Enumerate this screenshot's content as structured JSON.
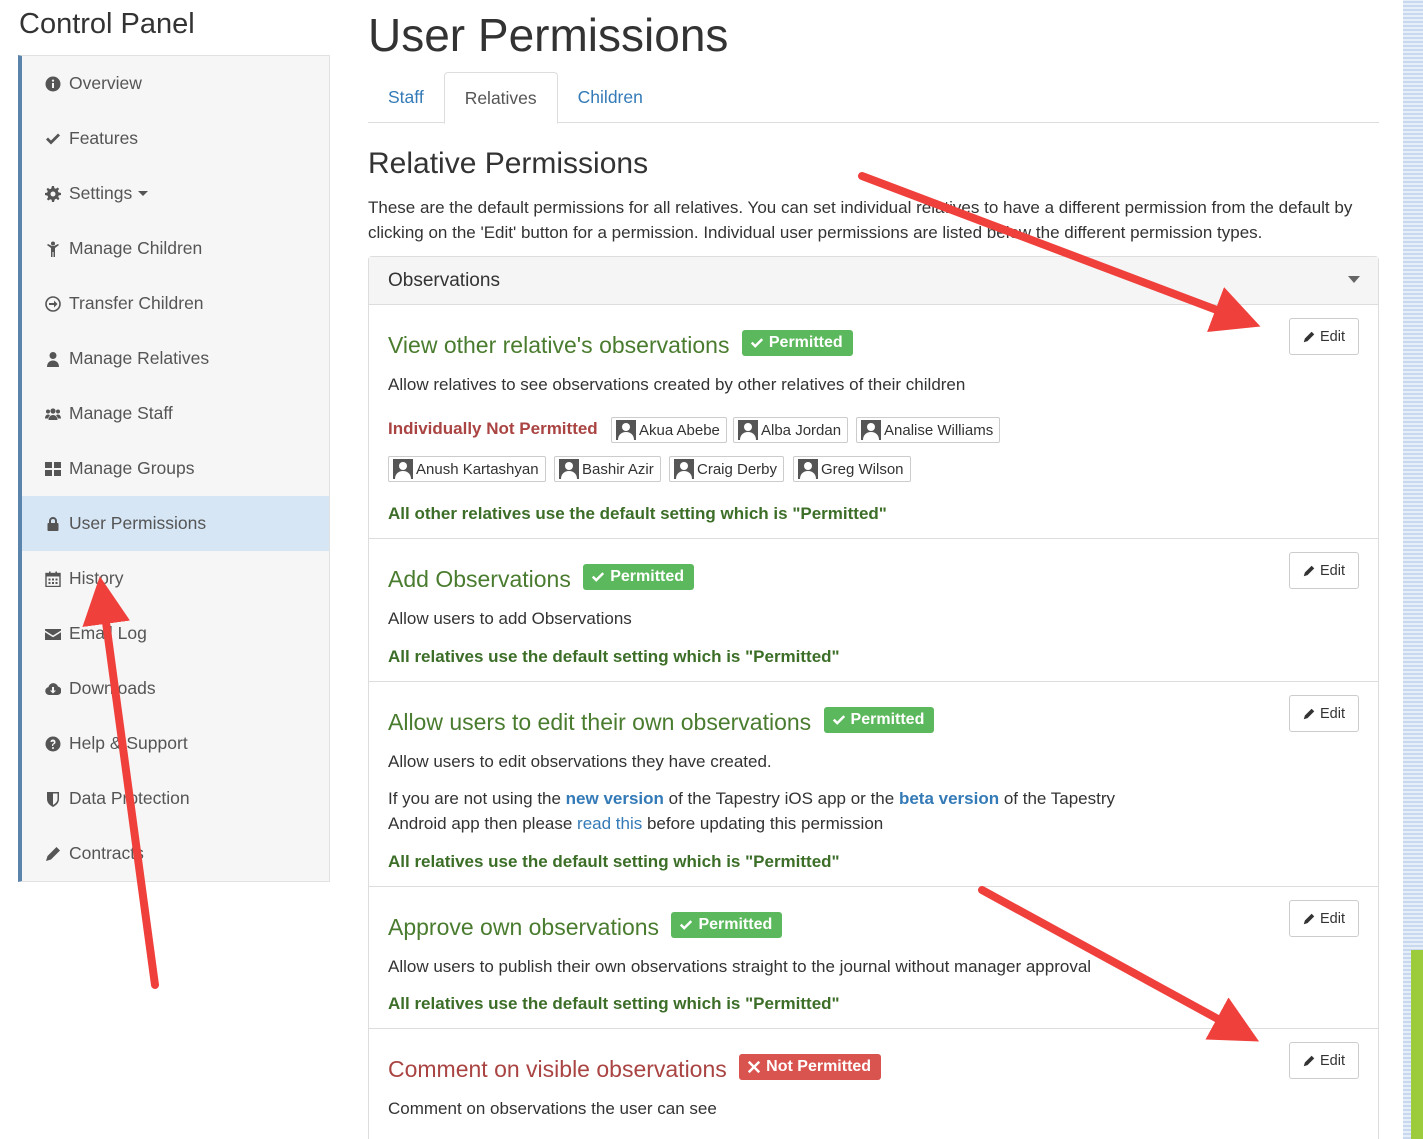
{
  "sidebar": {
    "title": "Control Panel",
    "items": [
      {
        "label": "Overview",
        "icon": "info-icon"
      },
      {
        "label": "Features",
        "icon": "check-icon"
      },
      {
        "label": "Settings",
        "icon": "gear-icon"
      },
      {
        "label": "Manage Children",
        "icon": "child-icon"
      },
      {
        "label": "Transfer Children",
        "icon": "transfer-icon"
      },
      {
        "label": "Manage Relatives",
        "icon": "user-icon"
      },
      {
        "label": "Manage Staff",
        "icon": "users-icon"
      },
      {
        "label": "Manage Groups",
        "icon": "groups-icon"
      },
      {
        "label": "User Permissions",
        "icon": "lock-icon",
        "active": true
      },
      {
        "label": "History",
        "icon": "calendar-icon"
      },
      {
        "label": "Email Log",
        "icon": "envelope-icon"
      },
      {
        "label": "Downloads",
        "icon": "cloud-download-icon"
      },
      {
        "label": "Help & Support",
        "icon": "question-icon"
      },
      {
        "label": "Data Protection",
        "icon": "shield-icon"
      },
      {
        "label": "Contracts",
        "icon": "pencil-icon"
      }
    ]
  },
  "main": {
    "title": "User Permissions",
    "tabs": [
      {
        "label": "Staff"
      },
      {
        "label": "Relatives",
        "active": true
      },
      {
        "label": "Children"
      }
    ],
    "section_title": "Relative Permissions",
    "section_desc": "These are the default permissions for all relatives. You can set individual relatives to have a different permission from the default by clicking on the 'Edit' button for a permission. Individual user permissions are listed below the different permission types.",
    "panel_heading": "Observations",
    "edit_label": "Edit",
    "permissions": [
      {
        "title": "View other relative's observations",
        "status": "Permitted",
        "desc": "Allow relatives to see observations created by other relatives of their children",
        "individual_label": "Individually Not Permitted",
        "users": [
          "Akua Abebe",
          "Alba Jordan",
          "Analise Williams",
          "Anush Kartashyan",
          "Bashir Azir",
          "Craig Derby",
          "Greg Wilson"
        ],
        "default_text": "All other relatives use the default setting which is \"Permitted\""
      },
      {
        "title": "Add Observations",
        "status": "Permitted",
        "desc": "Allow users to add Observations",
        "default_text": "All relatives use the default setting which is \"Permitted\""
      },
      {
        "title": "Allow users to edit their own observations",
        "status": "Permitted",
        "desc": "Allow users to edit observations they have created.",
        "note": {
          "t1": "If you are not using the ",
          "link1": "new version",
          "t2": " of the Tapestry iOS app or the ",
          "link2": "beta version",
          "t3": " of the Tapestry Android app then please ",
          "link3": "read this",
          "t4": " before updating this permission"
        },
        "default_text": "All relatives use the default setting which is \"Permitted\""
      },
      {
        "title": "Approve own observations",
        "status": "Permitted",
        "desc": "Allow users to publish their own observations straight to the journal without manager approval",
        "default_text": "All relatives use the default setting which is \"Permitted\""
      },
      {
        "title": "Comment on visible observations",
        "status": "Not Permitted",
        "desc": "Comment on observations the user can see"
      }
    ]
  },
  "colors": {
    "accent": "#337ab7",
    "permitted": "#5cb85c",
    "not_permitted": "#d9534f",
    "annotation_arrow": "#f0403c"
  }
}
